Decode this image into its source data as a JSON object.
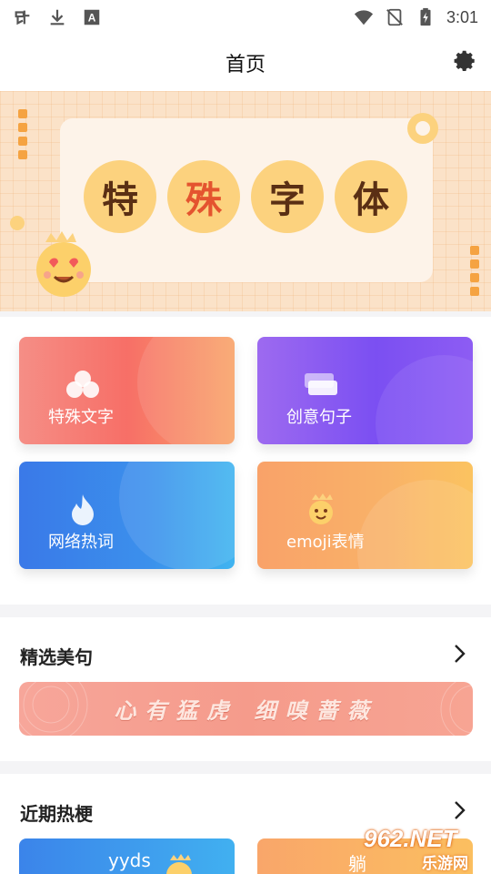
{
  "status_bar": {
    "time": "3:01"
  },
  "header": {
    "title": "首页"
  },
  "banner": {
    "chars": [
      "特",
      "殊",
      "字",
      "体"
    ]
  },
  "features": [
    {
      "label": "特殊文字",
      "icon": "cloud-icon"
    },
    {
      "label": "创意句子",
      "icon": "cards-icon"
    },
    {
      "label": "网络热词",
      "icon": "flame-icon"
    },
    {
      "label": "emoji表情",
      "icon": "emoji-icon"
    }
  ],
  "featured_quotes": {
    "title": "精选美句",
    "quote": "心有猛虎 细嗅蔷薇"
  },
  "hot_memes": {
    "title": "近期热梗",
    "cards": [
      {
        "label": "yyds"
      },
      {
        "label": "躺"
      }
    ]
  },
  "watermark": {
    "top": "962.NET",
    "bottom": "乐游网"
  },
  "colors": {
    "accent_gold": "#fcd27e",
    "banner_bg": "#fbe2c8"
  }
}
